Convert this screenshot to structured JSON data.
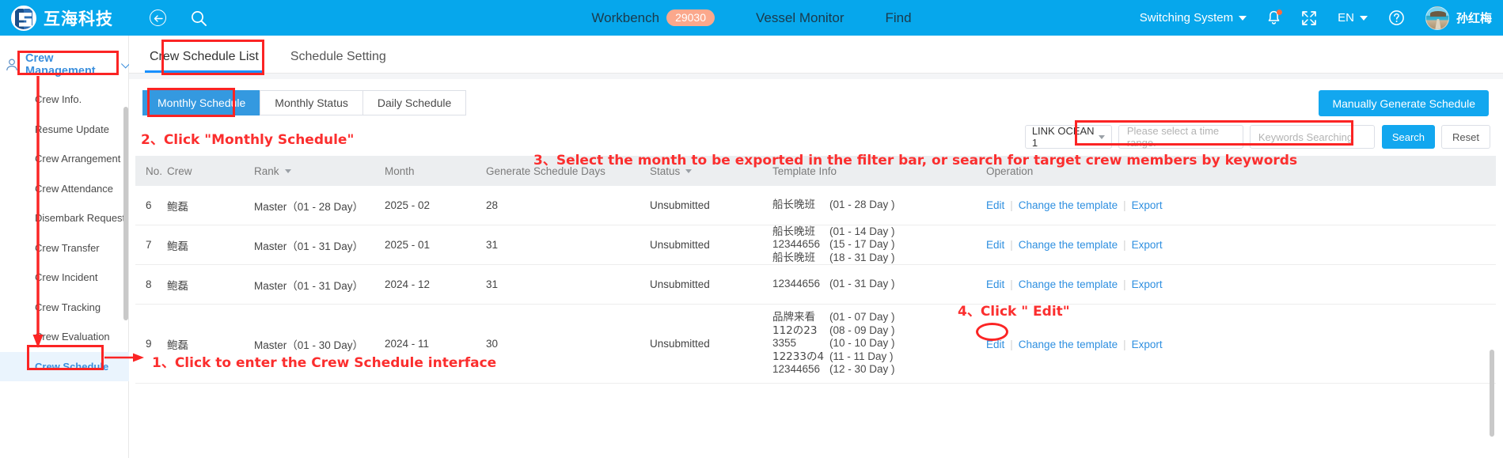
{
  "header": {
    "brand": "互海科技",
    "back_icon": "back-arrow-icon",
    "search_icon": "search-icon",
    "nav": [
      {
        "label": "Workbench",
        "badge": "29030"
      },
      {
        "label": "Vessel Monitor",
        "badge": ""
      },
      {
        "label": "Find",
        "badge": ""
      }
    ],
    "switching_system": "Switching System",
    "language": "EN",
    "user_name": "孙红梅",
    "bell_icon": "notification-bell-icon",
    "fullscreen_icon": "fullscreen-icon",
    "help_icon": "help-circle-icon"
  },
  "sidebar": {
    "group_title": "Crew Management",
    "group_icon": "person-icon",
    "items": [
      {
        "label": "Crew Info."
      },
      {
        "label": "Resume Update"
      },
      {
        "label": "Crew Arrangement"
      },
      {
        "label": "Crew Attendance"
      },
      {
        "label": "Disembark Request"
      },
      {
        "label": "Crew Transfer"
      },
      {
        "label": "Crew Incident"
      },
      {
        "label": "Crew Tracking"
      },
      {
        "label": "Crew Evaluation"
      },
      {
        "label": "Crew Schedule"
      }
    ]
  },
  "tabs": [
    {
      "label": "Crew Schedule List",
      "selected": true
    },
    {
      "label": "Schedule Setting",
      "selected": false
    }
  ],
  "segments": [
    {
      "label": "Monthly Schedule",
      "selected": true
    },
    {
      "label": "Monthly Status",
      "selected": false
    },
    {
      "label": "Daily Schedule",
      "selected": false
    }
  ],
  "actions": {
    "generate_button": "Manually Generate Schedule",
    "search_button": "Search",
    "reset_button": "Reset"
  },
  "filters": {
    "vessel_value": "LINK OCEAN 1",
    "time_range_placeholder": "Please select a time range.",
    "keywords_placeholder": "Keywords Searching"
  },
  "table": {
    "columns": [
      "No.",
      "Crew",
      "Rank",
      "Month",
      "Generate Schedule Days",
      "Status",
      "Template Info",
      "Operation"
    ],
    "rows": [
      {
        "no": "6",
        "crew": "鲍磊",
        "rank": "Master（01 - 28 Day）",
        "month": "2025 - 02",
        "days": "28",
        "status": "Unsubmitted",
        "templates": [
          {
            "name": "船长晚班",
            "range": "(01 - 28 Day )"
          }
        ],
        "ops": [
          "Edit",
          "Change the template",
          "Export"
        ]
      },
      {
        "no": "7",
        "crew": "鲍磊",
        "rank": "Master（01 - 31 Day）",
        "month": "2025 - 01",
        "days": "31",
        "status": "Unsubmitted",
        "templates": [
          {
            "name": "船长晚班",
            "range": "(01 - 14 Day )"
          },
          {
            "name": "12344656",
            "range": "(15 - 17 Day )"
          },
          {
            "name": "船长晚班",
            "range": "(18 - 31 Day )"
          }
        ],
        "ops": [
          "Edit",
          "Change the template",
          "Export"
        ]
      },
      {
        "no": "8",
        "crew": "鲍磊",
        "rank": "Master（01 - 31 Day）",
        "month": "2024 - 12",
        "days": "31",
        "status": "Unsubmitted",
        "templates": [
          {
            "name": "12344656",
            "range": "(01 - 31 Day )"
          }
        ],
        "ops": [
          "Edit",
          "Change the template",
          "Export"
        ]
      },
      {
        "no": "9",
        "crew": "鲍磊",
        "rank": "Master（01 - 30 Day）",
        "month": "2024 - 11",
        "days": "30",
        "status": "Unsubmitted",
        "templates": [
          {
            "name": "品牌来看",
            "range": "(01 - 07 Day )"
          },
          {
            "name": "112の23",
            "range": "(08 - 09 Day )"
          },
          {
            "name": "3355",
            "range": "(10 - 10 Day )"
          },
          {
            "name": "12233の4",
            "range": "(11 - 11 Day )"
          },
          {
            "name": "12344656",
            "range": "(12 - 30 Day )"
          }
        ],
        "ops": [
          "Edit",
          "Change the template",
          "Export"
        ]
      }
    ]
  },
  "annotations": {
    "step1": "1、Click to enter the Crew Schedule interface",
    "step2": "2、Click \"Monthly Schedule\"",
    "step3": "3、Select the month to be exported in the filter bar, or search for target crew members by keywords",
    "step4": "4、Click \" Edit\"",
    "color": "#fb2424"
  }
}
